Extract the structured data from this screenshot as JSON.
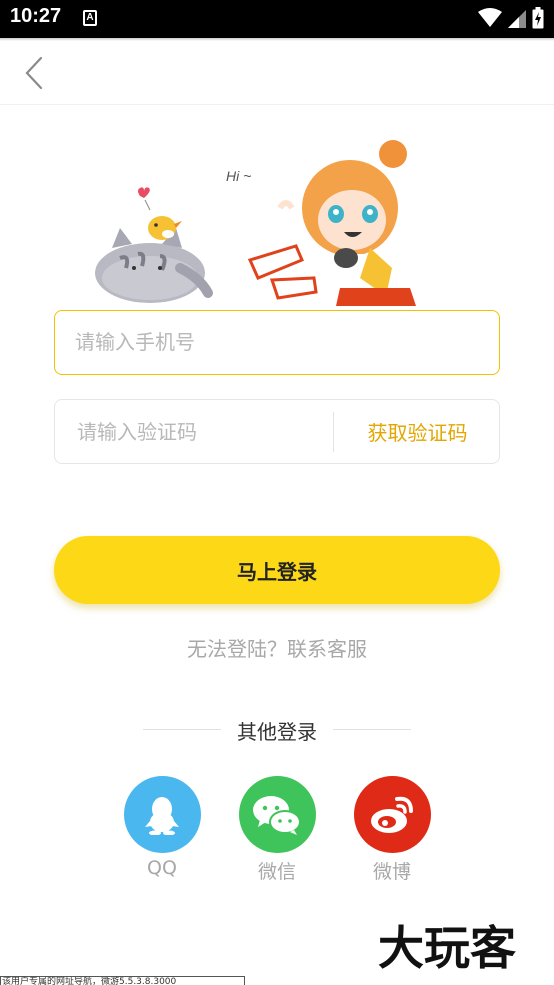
{
  "status_bar": {
    "time": "10:27",
    "notification_icon_letter": "A",
    "icons": [
      "wifi-icon",
      "signal-icon",
      "battery-icon"
    ]
  },
  "header": {
    "back_icon": "chevron-left-icon"
  },
  "illustration": {
    "speech_text": "Hi ~",
    "description_icons": [
      "cat-mascot",
      "bird-mascot",
      "anime-girl-mascot",
      "heart-icon"
    ]
  },
  "form": {
    "phone_placeholder": "请输入手机号",
    "phone_value": "",
    "code_placeholder": "请输入验证码",
    "code_value": "",
    "get_code_label": "获取验证码"
  },
  "login": {
    "button_label": "马上登录",
    "help_text": "无法登陆？联系客服"
  },
  "other_login": {
    "title": "其他登录",
    "providers": [
      {
        "label": "QQ",
        "icon": "qq-penguin-icon",
        "color": "#4bb7ef"
      },
      {
        "label": "微信",
        "icon": "wechat-icon",
        "color": "#3ec45a"
      },
      {
        "label": "微博",
        "icon": "weibo-icon",
        "color": "#de2a17"
      }
    ]
  },
  "watermark": {
    "text": "大玩客"
  },
  "bottom_tip": {
    "text": "该用户专属的网址导航，微游5.5.3.8.3000"
  },
  "colors": {
    "accent_yellow": "#fdd816",
    "accent_text": "#e3a600",
    "input_focus_border": "#f2c200"
  }
}
